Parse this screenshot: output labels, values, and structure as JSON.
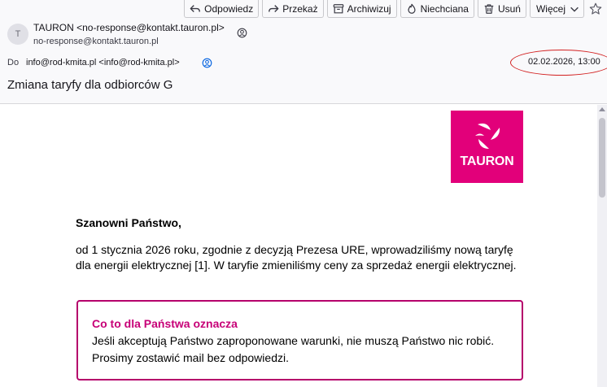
{
  "toolbar": {
    "reply": "Odpowiedz",
    "forward": "Przekaż",
    "archive": "Archiwizuj",
    "junk": "Niechciana",
    "delete": "Usuń",
    "more": "Więcej"
  },
  "message": {
    "avatar_initial": "T",
    "from_name": "TAURON <no-response@kontakt.tauron.pl>",
    "from_email": "no-response@kontakt.tauron.pl",
    "to_label": "Do",
    "to_value": "info@rod-kmita.pl <info@rod-kmita.pl>",
    "date": "02.02.2026, 13:00",
    "subject": "Zmiana taryfy dla odbiorców G"
  },
  "body": {
    "logo_text": "TAURON",
    "greeting": "Szanowni Państwo,",
    "paragraph": "od 1 stycznia 2026 roku, zgodnie z decyzją Prezesa URE, wprowadziliśmy nową taryfę dla energii elektrycznej [1]. W taryfie zmieniliśmy ceny za sprzedaż energii elektrycznej.",
    "box_title": "Co to dla Państwa oznacza",
    "box_text": "Jeśli akceptują Państwo zaproponowane warunki, nie muszą Państwo nic robić. Prosimy zostawić mail bez odpowiedzi."
  },
  "colors": {
    "brand": "#e2007a",
    "box_border": "#b5006b",
    "box_title": "#c70077",
    "annotation": "#d21f1f"
  },
  "icons": [
    "reply-icon",
    "forward-icon",
    "archive-icon",
    "junk-icon",
    "trash-icon",
    "chevron-down-icon",
    "star-icon",
    "contact-icon",
    "address-book-icon"
  ]
}
